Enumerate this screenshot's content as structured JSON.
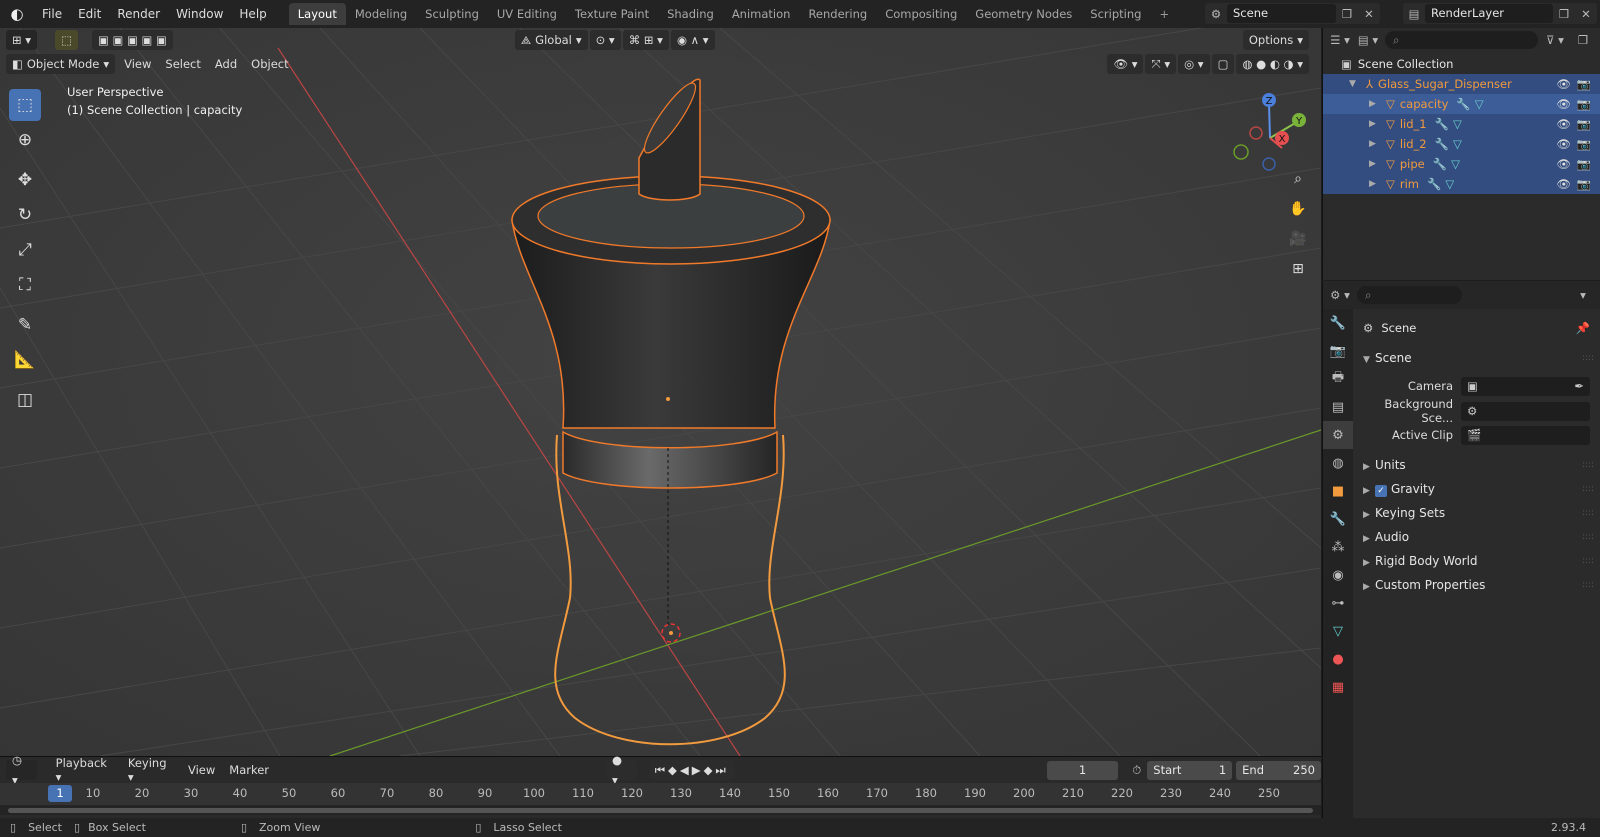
{
  "topbar": {
    "menus": [
      "File",
      "Edit",
      "Render",
      "Window",
      "Help"
    ],
    "workspaces": [
      "Layout",
      "Modeling",
      "Sculpting",
      "UV Editing",
      "Texture Paint",
      "Shading",
      "Animation",
      "Rendering",
      "Compositing",
      "Geometry Nodes",
      "Scripting"
    ],
    "active_workspace": "Layout",
    "scene": "Scene",
    "view_layer": "RenderLayer"
  },
  "viewport": {
    "transform_orientation": "Global",
    "options_label": "Options",
    "mode": "Object Mode",
    "menus": [
      "View",
      "Select",
      "Add",
      "Object"
    ],
    "perspective_label": "User Perspective",
    "collection_label": "(1) Scene Collection | capacity",
    "gizmo_axes": {
      "x": "X",
      "y": "Y",
      "z": "Z"
    }
  },
  "timeline": {
    "menus": [
      "Playback",
      "Keying",
      "View",
      "Marker"
    ],
    "current_frame": "1",
    "start_label": "Start",
    "start": "1",
    "end_label": "End",
    "end": "250",
    "ruler": [
      "1",
      "10",
      "20",
      "30",
      "40",
      "50",
      "60",
      "70",
      "80",
      "90",
      "100",
      "110",
      "120",
      "130",
      "140",
      "150",
      "160",
      "170",
      "180",
      "190",
      "200",
      "210",
      "220",
      "230",
      "240",
      "250"
    ]
  },
  "statusbar": {
    "items": [
      "Select",
      "Box Select",
      "Zoom View",
      "Lasso Select"
    ],
    "version": "2.93.4"
  },
  "outliner": {
    "root": "Scene Collection",
    "collection": "Glass_Sugar_Dispenser",
    "objects": [
      "capacity",
      "lid_1",
      "lid_2",
      "pipe",
      "rim"
    ]
  },
  "properties": {
    "context_title": "Scene",
    "section": "Scene",
    "fields": [
      {
        "label": "Camera",
        "value": ""
      },
      {
        "label": "Background Sce...",
        "value": ""
      },
      {
        "label": "Active Clip",
        "value": ""
      }
    ],
    "panels": [
      "Units",
      "Gravity",
      "Keying Sets",
      "Audio",
      "Rigid Body World",
      "Custom Properties"
    ]
  },
  "colors": {
    "accent": "#4772b3",
    "selection": "#f19a3e",
    "grid_x": "#b94545",
    "grid_y": "#6a9a2a"
  }
}
